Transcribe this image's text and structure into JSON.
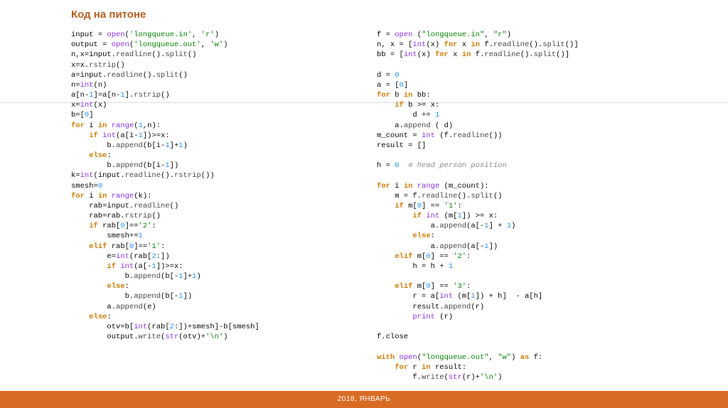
{
  "title": "Код на питоне",
  "footer": "2018, ЯНВАРЬ",
  "code_left": [
    {
      "t": "input = ",
      "bi": "open",
      "t2": "(",
      "s": "'longqueue.in'",
      "t3": ", ",
      "s2": "'r'",
      "t4": ")"
    },
    {
      "t": "output = ",
      "bi": "open",
      "t2": "(",
      "s": "'longqueue.out'",
      "t3": ", ",
      "s2": "'w'",
      "t4": ")"
    },
    {
      "t": "n,x=input.",
      "fn": "readline",
      "t2": "().",
      "fn2": "split",
      "t3": "()"
    },
    {
      "t": "x=x.",
      "fn": "rstrip",
      "t2": "()"
    },
    {
      "t": "a=input.",
      "fn": "readline",
      "t2": "().",
      "fn2": "split",
      "t3": "()"
    },
    {
      "t": "n=",
      "bi": "int",
      "t2": "(n)"
    },
    {
      "t": "a[n-",
      "n": "1",
      "t2": "]=a[n-",
      "n2": "1",
      "t3": "].",
      "fn": "rstrip",
      "t4": "()"
    },
    {
      "t": "x=",
      "bi": "int",
      "t2": "(x)"
    },
    {
      "t": "b=[",
      "n": "0",
      "t2": "]"
    },
    {
      "kw": "for",
      "t": " i ",
      "kw2": "in",
      "t2": " ",
      "bi": "range",
      "t3": "(",
      "n": "1",
      "t4": ",n):"
    },
    {
      "ind": 1,
      "kw": "if",
      "t": " ",
      "bi": "int",
      "t2": "(a[i-",
      "n": "1",
      "t3": "])>=x:"
    },
    {
      "ind": 2,
      "t": "b.",
      "fn": "append",
      "t2": "(b[i-",
      "n": "1",
      "t3": "]+",
      "n2": "1",
      "t4": ")"
    },
    {
      "ind": 1,
      "kw": "else",
      "t": ":"
    },
    {
      "ind": 2,
      "t": "b.",
      "fn": "append",
      "t2": "(b[i-",
      "n": "1",
      "t3": "])"
    },
    {
      "t": "k=",
      "bi": "int",
      "t2": "(input.",
      "fn": "readline",
      "t3": "().",
      "fn2": "rstrip",
      "t4": "())"
    },
    {
      "t": "smesh=",
      "n": "0"
    },
    {
      "kw": "for",
      "t": " i ",
      "kw2": "in",
      "t2": " ",
      "bi": "range",
      "t3": "(k):"
    },
    {
      "ind": 1,
      "t": "rab=input.",
      "fn": "readline",
      "t2": "()"
    },
    {
      "ind": 1,
      "t": "rab=rab.",
      "fn": "rstrip",
      "t2": "()"
    },
    {
      "ind": 1,
      "kw": "if",
      "t": " rab[",
      "n": "0",
      "t2": "]==",
      "s": "'2'",
      "t3": ":"
    },
    {
      "ind": 2,
      "t": "smesh+=",
      "n": "1"
    },
    {
      "ind": 1,
      "kw": "elif",
      "t": " rab[",
      "n": "0",
      "t2": "]==",
      "s": "'1'",
      "t3": ":"
    },
    {
      "ind": 2,
      "t": "e=",
      "bi": "int",
      "t2": "(rab[",
      "n": "2",
      "t3": ":])"
    },
    {
      "ind": 2,
      "kw": "if",
      "t": " ",
      "bi": "int",
      "t2": "(a[-",
      "n": "1",
      "t3": "])>=x:"
    },
    {
      "ind": 3,
      "t": "b.",
      "fn": "append",
      "t2": "(b[-",
      "n": "1",
      "t3": "]+",
      "n2": "1",
      "t4": ")"
    },
    {
      "ind": 2,
      "kw": "else",
      "t": ":"
    },
    {
      "ind": 3,
      "t": "b.",
      "fn": "append",
      "t2": "(b[-",
      "n": "1",
      "t3": "])"
    },
    {
      "ind": 2,
      "t": "a.",
      "fn": "append",
      "t2": "(e)"
    },
    {
      "ind": 1,
      "kw": "else",
      "t": ":"
    },
    {
      "ind": 2,
      "t": "otv=b[",
      "bi": "int",
      "t2": "(rab[",
      "n": "2",
      "t3": ":])+smesh]-b[smesh]"
    },
    {
      "ind": 2,
      "t": "output.",
      "fn": "write",
      "t2": "(",
      "bi": "str",
      "t3": "(otv)+",
      "s": "'\\n'",
      "t4": ")"
    }
  ],
  "code_right": [
    {
      "t": "f = ",
      "bi": "open",
      "t2": " (",
      "s": "\"longqueue.in\"",
      "t3": ", ",
      "s2": "\"r\"",
      "t4": ")"
    },
    {
      "t": "n, x = [",
      "bi": "int",
      "t2": "(x) ",
      "kw": "for",
      "t3": " x ",
      "kw2": "in",
      "t4": " f.",
      "fn": "readline",
      "t5": "().",
      "fn2": "split",
      "t6": "()]"
    },
    {
      "t": "bb = [",
      "bi": "int",
      "t2": "(x) ",
      "kw": "for",
      "t3": " x ",
      "kw2": "in",
      "t4": " f.",
      "fn": "readline",
      "t5": "().",
      "fn2": "split",
      "t6": "()]"
    },
    {
      "blank": true
    },
    {
      "t": "d = ",
      "n": "0"
    },
    {
      "t": "a = [",
      "n": "0",
      "t2": "]"
    },
    {
      "kw": "for",
      "t": " b ",
      "kw2": "in",
      "t2": " bb:"
    },
    {
      "ind": 1,
      "kw": "if",
      "t": " b >= x:"
    },
    {
      "ind": 2,
      "t": "d += ",
      "n": "1"
    },
    {
      "ind": 1,
      "t": "a.",
      "fn": "append",
      "t2": " ( d)"
    },
    {
      "t": "m_count = ",
      "bi": "int",
      "t2": " (f.",
      "fn": "readline",
      "t3": "())"
    },
    {
      "t": "result = []"
    },
    {
      "blank": true
    },
    {
      "t": "h = ",
      "n": "0",
      "t2": "  ",
      "cm": "# head person position"
    },
    {
      "blank": true
    },
    {
      "kw": "for",
      "t": " i ",
      "kw2": "in",
      "t2": " ",
      "bi": "range",
      "t3": " (m_count):"
    },
    {
      "ind": 1,
      "t": "m = f.",
      "fn": "readline",
      "t2": "().",
      "fn2": "split",
      "t3": "()"
    },
    {
      "ind": 1,
      "kw": "if",
      "t": " m[",
      "n": "0",
      "t2": "] == ",
      "s": "'1'",
      "t3": ":"
    },
    {
      "ind": 2,
      "kw": "if",
      "t": " ",
      "bi": "int",
      "t2": " (m[",
      "n": "1",
      "t3": "]) >= x:"
    },
    {
      "ind": 3,
      "t": "a.",
      "fn": "append",
      "t2": "(a[-",
      "n": "1",
      "t3": "] + ",
      "n2": "1",
      "t4": ")"
    },
    {
      "ind": 2,
      "kw": "else",
      "t": ":"
    },
    {
      "ind": 3,
      "t": "a.",
      "fn": "append",
      "t2": "(a[-",
      "n": "1",
      "t3": "])"
    },
    {
      "ind": 1,
      "kw": "elif",
      "t": " m[",
      "n": "0",
      "t2": "] == ",
      "s": "'2'",
      "t3": ":"
    },
    {
      "ind": 2,
      "t": "h = h + ",
      "n": "1"
    },
    {
      "blank": true
    },
    {
      "ind": 1,
      "kw": "elif",
      "t": " m[",
      "n": "0",
      "t2": "] == ",
      "s": "'3'",
      "t3": ":"
    },
    {
      "ind": 2,
      "t": "r = a[",
      "bi": "int",
      "t2": " (m[",
      "n": "1",
      "t3": "]) + h]  - a[h]"
    },
    {
      "ind": 2,
      "t": "result.",
      "fn": "append",
      "t2": "(r)"
    },
    {
      "ind": 2,
      "bi": "print",
      "t": " (r)"
    },
    {
      "blank": true
    },
    {
      "t": "f.close"
    },
    {
      "blank": true
    },
    {
      "kw": "with",
      "t": " ",
      "bi": "open",
      "t2": "(",
      "s": "\"longqueue.out\"",
      "t3": ", ",
      "s2": "\"w\"",
      "t4": ") ",
      "kw2": "as",
      "t5": " f:"
    },
    {
      "ind": 1,
      "kw": "for",
      "t": " r ",
      "kw2": "in",
      "t2": " result:"
    },
    {
      "ind": 2,
      "t": "f.",
      "fn": "write",
      "t2": "(",
      "bi": "str",
      "t3": "(r)+",
      "s": "'\\n'",
      "t4": ")"
    }
  ]
}
